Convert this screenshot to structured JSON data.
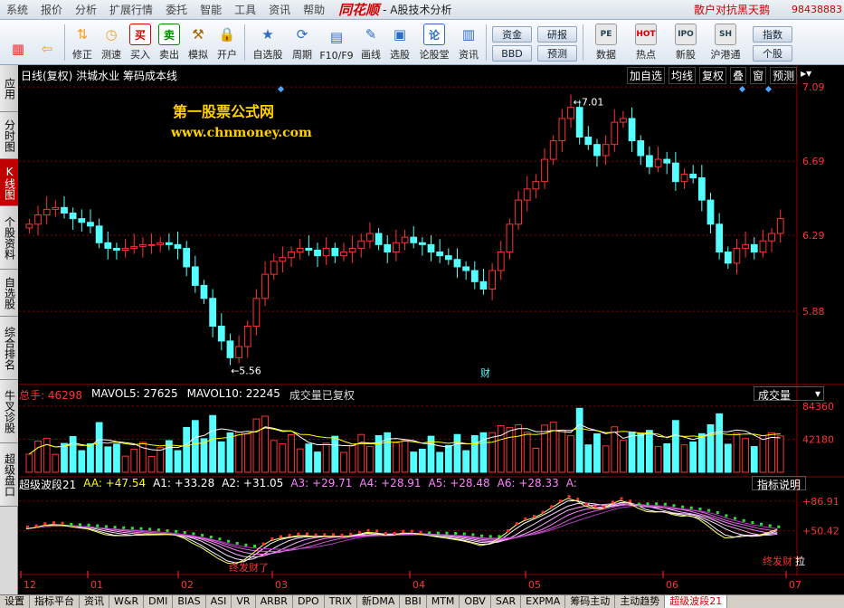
{
  "menu": {
    "items": [
      "系统",
      "报价",
      "分析",
      "扩展行情",
      "委托",
      "智能",
      "工具",
      "资讯",
      "帮助"
    ],
    "brand": "同花顺",
    "brand_sub": "- A股技术分析",
    "news_title": "散户对抗黑天鹅",
    "phone": "98438883"
  },
  "toolbar": {
    "buttons": [
      {
        "label": "",
        "icon": "grid-icon",
        "color": "#e33"
      },
      {
        "label": "",
        "icon": "back-arrow-icon",
        "color": "#f0a020"
      },
      {
        "label": "修正",
        "icon": "up-down-arrows-icon",
        "color": "#f0a020"
      },
      {
        "label": "测速",
        "icon": "clock-icon",
        "color": "#f0a020"
      },
      {
        "label": "买入",
        "icon": "buy-icon",
        "color": "#d00",
        "glyph": "买"
      },
      {
        "label": "卖出",
        "icon": "sell-icon",
        "color": "#080",
        "glyph": "卖"
      },
      {
        "label": "模拟",
        "icon": "hammer-icon",
        "color": "#a60"
      },
      {
        "label": "开户",
        "icon": "lock-icon",
        "color": "#888"
      },
      {
        "label": "自选股",
        "icon": "star-folder-icon",
        "color": "#2a6ac8"
      },
      {
        "label": "周期",
        "icon": "cycle-clock-icon",
        "color": "#2a6ac8"
      },
      {
        "label": "F10/F9",
        "icon": "f10-icon",
        "color": "#2a6ac8"
      },
      {
        "label": "画线",
        "icon": "pencil-icon",
        "color": "#2a6ac8"
      },
      {
        "label": "选股",
        "icon": "monitor-icon",
        "color": "#2a6ac8"
      },
      {
        "label": "论股堂",
        "icon": "forum-icon",
        "color": "#2a6ac8",
        "glyph": "论"
      },
      {
        "label": "资讯",
        "icon": "doc-icon",
        "color": "#2a6ac8"
      }
    ],
    "pills_a": [
      "资金",
      "BBD"
    ],
    "pills_b": [
      "研报",
      "预测"
    ],
    "right_buttons": [
      {
        "label": "数据",
        "icon": "pe-icon",
        "glyph": "PE"
      },
      {
        "label": "热点",
        "icon": "hot-icon",
        "glyph": "HOT"
      },
      {
        "label": "新股",
        "icon": "ipo-icon",
        "glyph": "IPO"
      },
      {
        "label": "沪港通",
        "icon": "sse-hkex-icon",
        "glyph": "SH"
      }
    ],
    "far_right": [
      "指数",
      "个股"
    ]
  },
  "left_tabs": [
    "应用",
    "分时图",
    "K线图",
    "个股资料",
    "自选股",
    "综合排名",
    "牛叉诊股",
    "超级盘口"
  ],
  "kline": {
    "title": "日线(复权) 洪城水业 筹码成本线",
    "controls": [
      "加自选",
      "均线",
      "复权",
      "叠",
      "窗",
      "预测"
    ],
    "watermark_title": "第一股票公式网",
    "watermark_url": "www.chnmoney.com",
    "y_ticks": [
      "7.09",
      "6.69",
      "6.29",
      "5.88"
    ],
    "high_label": "7.01",
    "low_label": "5.56",
    "finance_marker": "财"
  },
  "volume": {
    "label_total": "总手: 46298",
    "mavol5": "MAVOL5: 27625",
    "mavol10": "MAVOL10: 22245",
    "note": "成交量已复权",
    "selector": "成交量",
    "y_ticks": [
      "84360",
      "42180"
    ]
  },
  "indicator": {
    "name": "超级波段21",
    "values": [
      {
        "label": "AA: +47.54",
        "color": "#ffff00"
      },
      {
        "label": "A1: +33.28",
        "color": "#ffffff"
      },
      {
        "label": "A2: +31.05",
        "color": "#ffffff"
      },
      {
        "label": "A3: +29.71",
        "color": "#ff80ff"
      },
      {
        "label": "A4: +28.91",
        "color": "#ff80ff"
      },
      {
        "label": "A5: +28.48",
        "color": "#ff80ff"
      },
      {
        "label": "A6: +28.33",
        "color": "#ff80ff"
      },
      {
        "label": "A:",
        "color": "#ff80ff"
      }
    ],
    "help_button": "指标说明",
    "y_ticks": [
      "+86.91",
      "+50.42"
    ],
    "signal_1": "终发财了",
    "signal_2": "终发财了",
    "signal_3": "拉"
  },
  "x_axis": [
    "12",
    "01",
    "02",
    "03",
    "04",
    "05",
    "06",
    "07"
  ],
  "bottom_tabs": [
    "设置",
    "指标平台",
    "资讯",
    "W&R",
    "DMI",
    "BIAS",
    "ASI",
    "VR",
    "ARBR",
    "DPO",
    "TRIX",
    "新DMA",
    "BBI",
    "MTM",
    "OBV",
    "SAR",
    "EXPMA",
    "筹码主动",
    "主动趋势",
    "超级波段21"
  ],
  "colors": {
    "up": "#ff3232",
    "down": "#54ffff",
    "grid": "#8b0000",
    "axis_text": "#ff3232"
  },
  "chart_data": {
    "type": "candlestick",
    "symbol": "洪城水业",
    "x_months": [
      "12",
      "01",
      "02",
      "03",
      "04",
      "05",
      "06",
      "07"
    ],
    "price_ylim": [
      5.5,
      7.12
    ],
    "price_high": 7.01,
    "price_low": 5.56,
    "closes": [
      6.35,
      6.4,
      6.43,
      6.44,
      6.41,
      6.38,
      6.36,
      6.34,
      6.25,
      6.22,
      6.21,
      6.22,
      6.23,
      6.24,
      6.24,
      6.25,
      6.24,
      6.22,
      6.12,
      6.02,
      5.95,
      5.8,
      5.72,
      5.63,
      5.69,
      5.8,
      5.95,
      6.08,
      6.15,
      6.17,
      6.2,
      6.22,
      6.21,
      6.18,
      6.22,
      6.18,
      6.2,
      6.22,
      6.26,
      6.3,
      6.24,
      6.2,
      6.25,
      6.28,
      6.25,
      6.24,
      6.2,
      6.18,
      6.16,
      6.12,
      6.1,
      6.04,
      6.0,
      6.1,
      6.2,
      6.35,
      6.48,
      6.54,
      6.58,
      6.7,
      6.8,
      6.92,
      6.98,
      6.82,
      6.78,
      6.72,
      6.78,
      6.9,
      6.92,
      6.8,
      6.72,
      6.66,
      6.7,
      6.68,
      6.58,
      6.62,
      6.6,
      6.48,
      6.35,
      6.2,
      6.14,
      6.22,
      6.24,
      6.2,
      6.26,
      6.3,
      6.38
    ],
    "volume_ylim": [
      0,
      90000
    ],
    "volume_last": 46298,
    "mavol5_last": 27625,
    "mavol10_last": 22245,
    "indicator_last": {
      "AA": 47.54,
      "A1": 33.28,
      "A2": 31.05,
      "A3": 29.71,
      "A4": 28.91,
      "A5": 28.48,
      "A6": 28.33
    }
  }
}
